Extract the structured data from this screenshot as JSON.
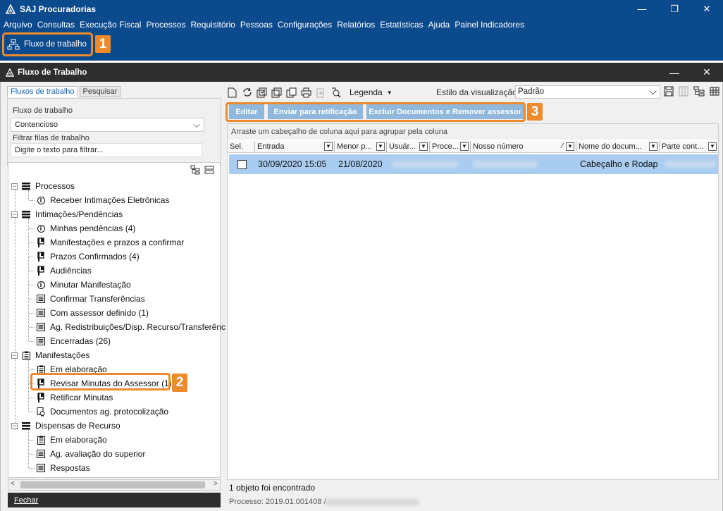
{
  "app": {
    "title": "SAJ Procuradorias",
    "minimize": "—",
    "restore": "❐",
    "close": "✕"
  },
  "menu": [
    "Arquivo",
    "Consultas",
    "Execução Fiscal",
    "Processos",
    "Requisitório",
    "Pessoas",
    "Configurações",
    "Relatórios",
    "Estatísticas",
    "Ajuda",
    "Painel Indicadores"
  ],
  "toolstrip": {
    "fluxo_label": "Fluxo de trabalho"
  },
  "badges": {
    "one": "1",
    "two": "2",
    "three": "3"
  },
  "inner_window": {
    "title": "Fluxo de Trabalho",
    "minimize": "—",
    "close": "✕"
  },
  "left": {
    "tab_fluxos": "Fluxos de trabalho",
    "tab_pesquisar": "Pesquisar",
    "fluxo_label": "Fluxo de trabalho",
    "fluxo_value": "Contencioso",
    "filtrar_label": "Filtrar filas de trabalho",
    "filtrar_placeholder": "Digite o texto para filtrar...",
    "fechar": "Fechar"
  },
  "tree": [
    {
      "label": "Processos",
      "level": 0,
      "icon": "list-icon"
    },
    {
      "label": "Receber Intimações Eletrônicas",
      "level": 1,
      "icon": "info-icon"
    },
    {
      "label": "Intimações/Pendências",
      "level": 0,
      "icon": "list-icon"
    },
    {
      "label": "Minhas pendências (4)",
      "level": 1,
      "icon": "info-icon"
    },
    {
      "label": "Manifestações e prazos a confirmar",
      "level": 1,
      "icon": "flag-icon"
    },
    {
      "label": "Prazos Confirmados (4)",
      "level": 1,
      "icon": "flag-icon"
    },
    {
      "label": "Audiências",
      "level": 1,
      "icon": "flag-icon"
    },
    {
      "label": "Minutar Manifestação",
      "level": 1,
      "icon": "info-icon"
    },
    {
      "label": "Confirmar Transferências",
      "level": 1,
      "icon": "form-icon"
    },
    {
      "label": "Com assessor definido (1)",
      "level": 1,
      "icon": "form-icon"
    },
    {
      "label": "Ag. Redistribuições/Disp. Recurso/Transferênc",
      "level": 1,
      "icon": "form-icon"
    },
    {
      "label": "Encerradas (26)",
      "level": 1,
      "icon": "form-icon"
    },
    {
      "label": "Manifestações",
      "level": 0,
      "icon": "clipboard-icon"
    },
    {
      "label": "Em elaboração",
      "level": 1,
      "icon": "clipboard-icon"
    },
    {
      "label": "Revisar Minutas do Assessor (1)",
      "level": 1,
      "icon": "flag-icon"
    },
    {
      "label": "Retificar Minutas",
      "level": 1,
      "icon": "flag-icon"
    },
    {
      "label": "Documentos ag. protocolização",
      "level": 1,
      "icon": "seal-icon"
    },
    {
      "label": "Dispensas de Recurso",
      "level": 0,
      "icon": "list-icon"
    },
    {
      "label": "Em elaboração",
      "level": 1,
      "icon": "clipboard-icon"
    },
    {
      "label": "Ag. avaliação do superior",
      "level": 1,
      "icon": "form-icon"
    },
    {
      "label": "Respostas",
      "level": 1,
      "icon": "form-icon"
    }
  ],
  "toolbar": {
    "legenda": "Legenda",
    "estilo_label": "Estilo da visualização",
    "estilo_value": "Padrão"
  },
  "actions": {
    "editar": "Editar",
    "enviar": "Enviar para retificação",
    "excluir": "Excluir Documentos e Remover assessor"
  },
  "grid": {
    "group_hint": "Arraste um cabeçalho de coluna aqui para agrupar pela coluna",
    "columns": [
      "Sel.",
      "Entrada",
      "Menor p...",
      "Usuár...",
      "Proce...",
      "Nosso número",
      "Nome do docum...",
      "Parte cont..."
    ],
    "row": {
      "entrada": "30/09/2020 15:05",
      "menor_prazo": "21/08/2020",
      "nome_documento": "Cabeçalho e Rodap"
    }
  },
  "status": {
    "count": "1 objeto foi encontrado",
    "processo": "Processo: 2019.01.001408 /"
  }
}
